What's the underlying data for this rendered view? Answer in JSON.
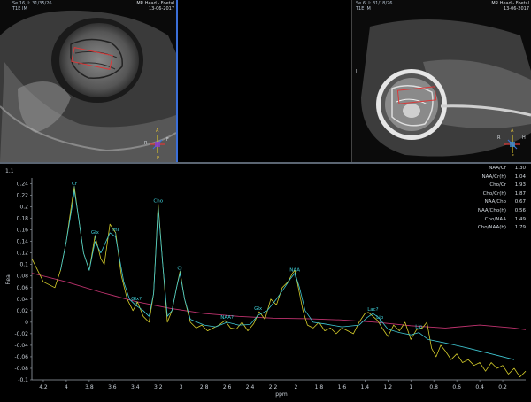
{
  "left_view": {
    "top_left": "Se 16, I: 31/35/26",
    "top_left_2": "T1E   IM",
    "top_right": "MR Head - Foetal",
    "top_right_2": "13-06-2017",
    "side_letter": "I",
    "orient": {
      "top": "A",
      "bottom": "P",
      "left": "R",
      "right": "F"
    }
  },
  "right_view": {
    "top_left": "Se 6, I: 31/18/26",
    "top_left_2": "T1E   IM",
    "top_right": "MR Head - Foetal",
    "top_right_2": "13-06-2017",
    "side_letter": "I",
    "orient": {
      "top": "A",
      "bottom": "F",
      "left": "R",
      "right": "H"
    }
  },
  "spectrum_label": "1.1",
  "ratios": [
    {
      "label": "NAA/Cr",
      "value": "1.30"
    },
    {
      "label": "NAA/Cr(h)",
      "value": "1.04"
    },
    {
      "label": "Cho/Cr",
      "value": "1.93"
    },
    {
      "label": "Cho/Cr(h)",
      "value": "1.87"
    },
    {
      "label": "NAA/Cho",
      "value": "0.67"
    },
    {
      "label": "NAA/Cho(h)",
      "value": "0.56"
    },
    {
      "label": "Cho/NAA",
      "value": "1.49"
    },
    {
      "label": "Cho/NAA(h)",
      "value": "1.79"
    }
  ],
  "chart_data": {
    "type": "line",
    "xlabel": "ppm",
    "ylabel": "Real",
    "xlim": [
      4.3,
      0.0
    ],
    "ylim": [
      -0.1,
      0.25
    ],
    "x_ticks": [
      "4.2",
      "4",
      "3.8",
      "3.6",
      "3.4",
      "3.2",
      "3",
      "2.8",
      "2.6",
      "2.4",
      "2.2",
      "2",
      "1.8",
      "1.6",
      "1.4",
      "1.2",
      "1",
      "0.8",
      "0.6",
      "0.4",
      "0.2"
    ],
    "y_ticks": [
      "0.24",
      "0.22",
      "0.2",
      "0.18",
      "0.16",
      "0.14",
      "0.12",
      "0.1",
      "0.08",
      "0.06",
      "0.04",
      "0.02",
      "0",
      "-0.02",
      "-0.04",
      "-0.06",
      "-0.08",
      "-0.1"
    ],
    "peak_labels": [
      {
        "text": "Cr",
        "x": 3.93,
        "y": 0.235
      },
      {
        "text": "Glx",
        "x": 3.75,
        "y": 0.15
      },
      {
        "text": "mI",
        "x": 3.57,
        "y": 0.155
      },
      {
        "text": "Cho",
        "x": 3.2,
        "y": 0.205
      },
      {
        "text": "Cr",
        "x": 3.01,
        "y": 0.088
      },
      {
        "text": "Glx?",
        "x": 3.39,
        "y": 0.035
      },
      {
        "text": "NAA?",
        "x": 2.6,
        "y": 0.003
      },
      {
        "text": "Glx",
        "x": 2.33,
        "y": 0.018
      },
      {
        "text": "NAA",
        "x": 2.01,
        "y": 0.085
      },
      {
        "text": "Lac?",
        "x": 1.33,
        "y": 0.017
      },
      {
        "text": "Lip",
        "x": 1.27,
        "y": 0.003
      },
      {
        "text": "Lip",
        "x": 0.93,
        "y": -0.013
      }
    ],
    "series": [
      {
        "color": "#d4cc2a",
        "x": [
          4.3,
          4.2,
          4.1,
          4.05,
          4.0,
          3.95,
          3.93,
          3.9,
          3.85,
          3.8,
          3.75,
          3.7,
          3.67,
          3.62,
          3.57,
          3.52,
          3.47,
          3.42,
          3.38,
          3.33,
          3.28,
          3.24,
          3.2,
          3.16,
          3.12,
          3.08,
          3.04,
          3.01,
          2.97,
          2.92,
          2.87,
          2.82,
          2.77,
          2.72,
          2.67,
          2.62,
          2.57,
          2.52,
          2.47,
          2.42,
          2.37,
          2.32,
          2.27,
          2.22,
          2.17,
          2.12,
          2.07,
          2.03,
          2.01,
          1.98,
          1.94,
          1.9,
          1.85,
          1.8,
          1.75,
          1.7,
          1.65,
          1.6,
          1.55,
          1.5,
          1.45,
          1.4,
          1.37,
          1.33,
          1.29,
          1.25,
          1.2,
          1.15,
          1.1,
          1.05,
          1.0,
          0.95,
          0.9,
          0.86,
          0.82,
          0.78,
          0.74,
          0.7,
          0.65,
          0.6,
          0.55,
          0.5,
          0.45,
          0.4,
          0.35,
          0.3,
          0.25,
          0.2,
          0.15,
          0.1,
          0.05,
          0.0
        ],
        "y": [
          0.11,
          0.07,
          0.06,
          0.09,
          0.14,
          0.21,
          0.235,
          0.19,
          0.12,
          0.09,
          0.15,
          0.11,
          0.1,
          0.17,
          0.155,
          0.08,
          0.04,
          0.02,
          0.035,
          0.01,
          0.0,
          0.05,
          0.205,
          0.1,
          0.0,
          0.02,
          0.06,
          0.088,
          0.04,
          0.0,
          -0.01,
          -0.005,
          -0.015,
          -0.01,
          -0.005,
          0.003,
          -0.01,
          -0.012,
          0.0,
          -0.015,
          -0.003,
          0.018,
          0.005,
          0.04,
          0.03,
          0.06,
          0.07,
          0.085,
          0.09,
          0.06,
          0.02,
          -0.005,
          -0.01,
          0.0,
          -0.015,
          -0.01,
          -0.02,
          -0.01,
          -0.015,
          -0.02,
          0.0,
          0.015,
          0.017,
          0.01,
          0.003,
          -0.01,
          -0.025,
          -0.005,
          -0.015,
          0.0,
          -0.03,
          -0.013,
          -0.01,
          0.0,
          -0.045,
          -0.06,
          -0.04,
          -0.05,
          -0.065,
          -0.055,
          -0.07,
          -0.065,
          -0.075,
          -0.07,
          -0.085,
          -0.07,
          -0.08,
          -0.075,
          -0.09,
          -0.08,
          -0.095,
          -0.085
        ]
      },
      {
        "color": "#3fc7d3",
        "x": [
          4.05,
          4.0,
          3.95,
          3.93,
          3.9,
          3.85,
          3.8,
          3.75,
          3.7,
          3.62,
          3.57,
          3.5,
          3.45,
          3.4,
          3.33,
          3.28,
          3.24,
          3.2,
          3.16,
          3.12,
          3.08,
          3.04,
          3.01,
          2.97,
          2.92,
          2.8,
          2.7,
          2.6,
          2.5,
          2.4,
          2.33,
          2.25,
          2.17,
          2.1,
          2.05,
          2.01,
          1.97,
          1.92,
          1.85,
          1.75,
          1.6,
          1.45,
          1.38,
          1.33,
          1.28,
          1.2,
          1.1,
          1.0,
          0.93,
          0.85,
          0.7,
          0.5,
          0.3,
          0.1
        ],
        "y": [
          0.09,
          0.14,
          0.2,
          0.228,
          0.19,
          0.12,
          0.09,
          0.14,
          0.12,
          0.155,
          0.148,
          0.07,
          0.04,
          0.03,
          0.02,
          0.01,
          0.05,
          0.2,
          0.1,
          0.01,
          0.02,
          0.06,
          0.085,
          0.04,
          0.005,
          -0.005,
          -0.008,
          0.0,
          -0.005,
          -0.004,
          0.012,
          0.02,
          0.04,
          0.06,
          0.075,
          0.085,
          0.06,
          0.02,
          0.0,
          -0.003,
          -0.008,
          -0.005,
          0.008,
          0.015,
          0.008,
          -0.012,
          -0.018,
          -0.022,
          -0.018,
          -0.03,
          -0.036,
          -0.045,
          -0.055,
          -0.065
        ]
      },
      {
        "color": "#c0336f",
        "x": [
          4.3,
          4.0,
          3.7,
          3.4,
          3.1,
          2.8,
          2.5,
          2.2,
          1.9,
          1.6,
          1.3,
          1.0,
          0.7,
          0.4,
          0.1,
          0.0
        ],
        "y": [
          0.085,
          0.07,
          0.052,
          0.036,
          0.024,
          0.015,
          0.01,
          0.007,
          0.006,
          0.004,
          0.0,
          -0.006,
          -0.01,
          -0.005,
          -0.01,
          -0.013
        ]
      }
    ]
  }
}
